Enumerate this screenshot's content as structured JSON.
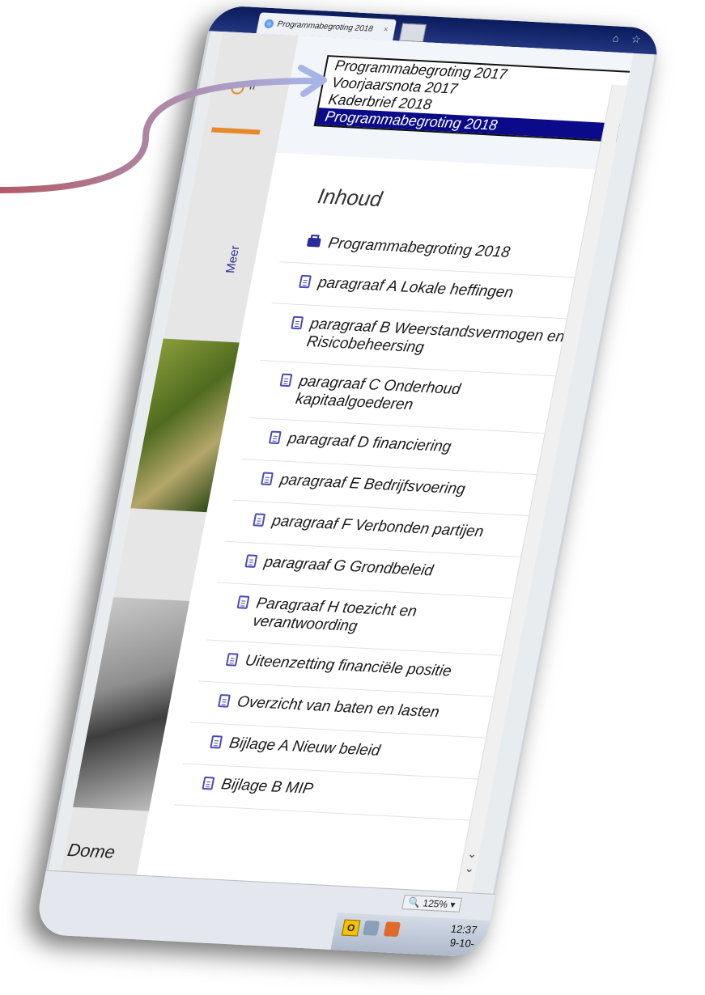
{
  "browser": {
    "tab_title": "Programmabegroting 2018",
    "tab_close": "×",
    "title_icons": "⌂ ☆"
  },
  "dropdown": {
    "options": [
      "Programmabegroting 2017",
      "Voorjaarsnota 2017",
      "Kaderbrief 2018",
      "Programmabegroting 2018"
    ],
    "selected_index": 3
  },
  "sidebar": {
    "search_partial": "II",
    "meer_label": "Meer",
    "bottom_label": "Dome"
  },
  "toc": {
    "title": "Inhoud",
    "items": [
      {
        "icon": "print-icon",
        "label": "Programmabegroting 2018"
      },
      {
        "icon": "document-icon",
        "label": "paragraaf A Lokale heffingen"
      },
      {
        "icon": "document-icon",
        "label": "paragraaf B Weerstandsvermogen en Risicobeheersing"
      },
      {
        "icon": "document-icon",
        "label": "paragraaf C Onderhoud kapitaalgoederen"
      },
      {
        "icon": "document-icon",
        "label": "paragraaf D financiering"
      },
      {
        "icon": "document-icon",
        "label": "paragraaf E Bedrijfsvoering"
      },
      {
        "icon": "document-icon",
        "label": "paragraaf F Verbonden partijen"
      },
      {
        "icon": "document-icon",
        "label": "paragraaf G Grondbeleid"
      },
      {
        "icon": "document-icon",
        "label": "Paragraaf H toezicht en verantwoording"
      },
      {
        "icon": "document-icon",
        "label": "Uiteenzetting financiële positie"
      },
      {
        "icon": "document-icon",
        "label": "Overzicht van baten en lasten"
      },
      {
        "icon": "document-icon",
        "label": "Bijlage A Nieuw beleid"
      },
      {
        "icon": "document-icon",
        "label": "Bijlage B MIP"
      }
    ]
  },
  "statusbar": {
    "zoom": "125%",
    "tray_o": "O",
    "time": "12:37",
    "date": "9-10-"
  },
  "colors": {
    "accent_orange": "#e58a2b",
    "selection_blue": "#0b0b8a",
    "icon_blue": "#4a4ab0",
    "arrow_start": "#b35a66",
    "arrow_end": "#a8b4e6"
  }
}
